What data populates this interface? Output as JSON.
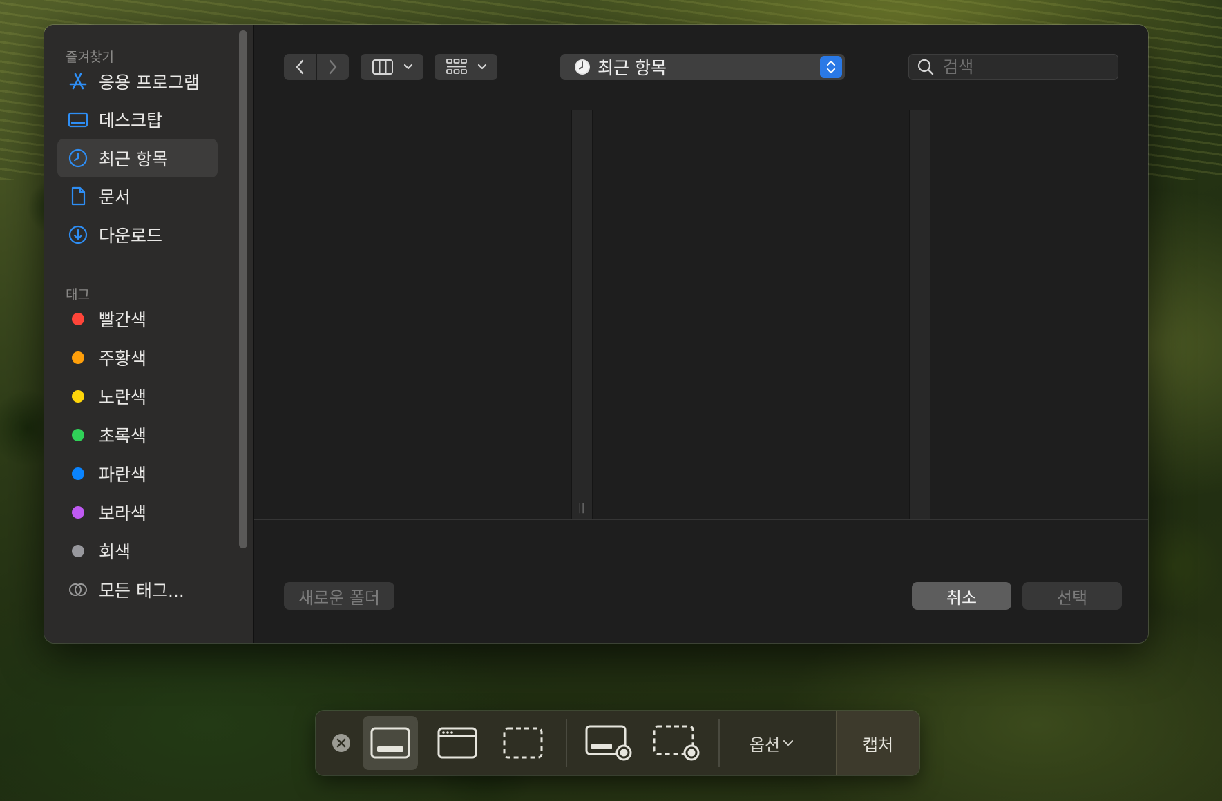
{
  "sidebar": {
    "favorites_heading": "즐겨찾기",
    "favorites": [
      {
        "label": "응용 프로그램",
        "icon": "app-store-icon"
      },
      {
        "label": "데스크탑",
        "icon": "desktop-icon"
      },
      {
        "label": "최근 항목",
        "icon": "clock-icon",
        "selected": true
      },
      {
        "label": "문서",
        "icon": "document-icon"
      },
      {
        "label": "다운로드",
        "icon": "download-icon"
      }
    ],
    "tags_heading": "태그",
    "tags": [
      {
        "label": "빨간색",
        "color": "#ff4539"
      },
      {
        "label": "주황색",
        "color": "#ff9f0a"
      },
      {
        "label": "노란색",
        "color": "#ffd60a"
      },
      {
        "label": "초록색",
        "color": "#30d158"
      },
      {
        "label": "파란색",
        "color": "#0a84ff"
      },
      {
        "label": "보라색",
        "color": "#bf5af2"
      },
      {
        "label": "회색",
        "color": "#98989d"
      }
    ],
    "all_tags": "모든 태그..."
  },
  "toolbar": {
    "location": "최근 항목",
    "search_placeholder": "검색"
  },
  "footer": {
    "new_folder": "새로운 폴더",
    "cancel": "취소",
    "select": "선택"
  },
  "capture_bar": {
    "options": "옵션",
    "capture": "캡처"
  },
  "colors": {
    "accent": "#2a79e6"
  }
}
